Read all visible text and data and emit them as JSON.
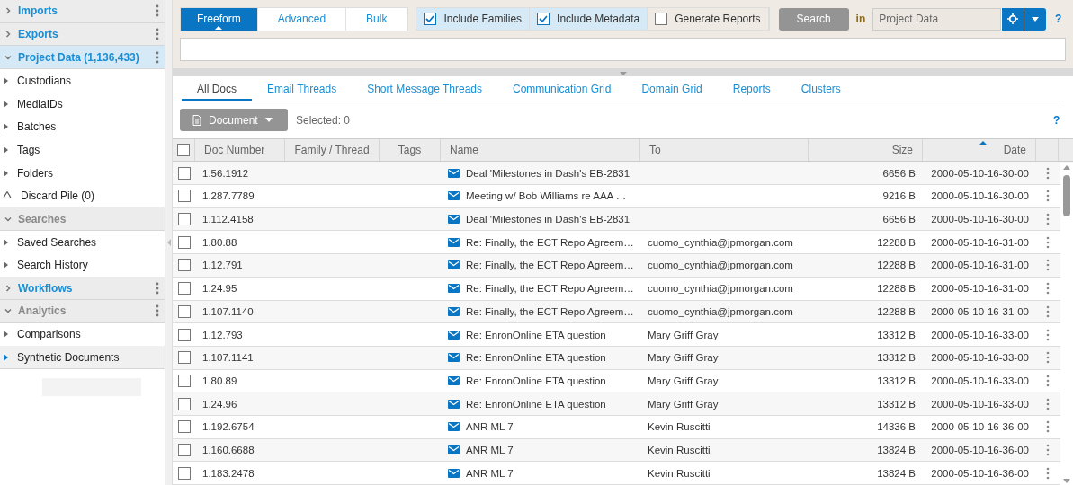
{
  "sidebar": {
    "sections": [
      {
        "label": "Imports",
        "expanded": false,
        "selected": false,
        "color": "#1a8ed4",
        "menu": true
      },
      {
        "label": "Exports",
        "expanded": false,
        "selected": false,
        "color": "#1a8ed4",
        "menu": true
      },
      {
        "label": "Project Data (1,136,433)",
        "expanded": true,
        "selected": true,
        "color": "#1a8ed4",
        "menu": true,
        "children": [
          {
            "label": "Custodians",
            "kind": "branch",
            "hovered": false
          },
          {
            "label": "MediaIDs",
            "kind": "branch",
            "hovered": false
          },
          {
            "label": "Batches",
            "kind": "branch",
            "hovered": false
          },
          {
            "label": "Tags",
            "kind": "branch",
            "hovered": false
          },
          {
            "label": "Folders",
            "kind": "branch",
            "hovered": false
          },
          {
            "label": "Discard Pile (0)",
            "kind": "discard",
            "hovered": false
          }
        ]
      },
      {
        "label": "Searches",
        "expanded": true,
        "selected": false,
        "color": "#8a8a8a",
        "menu": false,
        "children": [
          {
            "label": "Saved Searches",
            "kind": "branch",
            "hovered": false
          },
          {
            "label": "Search History",
            "kind": "branch",
            "hovered": false
          }
        ]
      },
      {
        "label": "Workflows",
        "expanded": false,
        "selected": false,
        "color": "#1a8ed4",
        "menu": true
      },
      {
        "label": "Analytics",
        "expanded": true,
        "selected": false,
        "color": "#8a8a8a",
        "menu": true,
        "children": [
          {
            "label": "Comparisons",
            "kind": "branch",
            "hovered": false
          },
          {
            "label": "Synthetic Documents",
            "kind": "branch",
            "hovered": true
          }
        ]
      }
    ]
  },
  "search": {
    "modes": [
      {
        "label": "Freeform",
        "selected": true
      },
      {
        "label": "Advanced",
        "selected": false
      },
      {
        "label": "Bulk",
        "selected": false
      }
    ],
    "options": [
      {
        "label": "Include Families",
        "checked": true
      },
      {
        "label": "Include Metadata",
        "checked": true
      },
      {
        "label": "Generate Reports",
        "checked": false
      }
    ],
    "search_button": {
      "label": "Search",
      "disabled": true
    },
    "in_label": "in",
    "scope": "Project Data",
    "help": "?"
  },
  "tabs": [
    {
      "label": "All Docs",
      "selected": true
    },
    {
      "label": "Email Threads",
      "selected": false
    },
    {
      "label": "Short Message Threads",
      "selected": false
    },
    {
      "label": "Communication Grid",
      "selected": false
    },
    {
      "label": "Domain Grid",
      "selected": false
    },
    {
      "label": "Reports",
      "selected": false
    },
    {
      "label": "Clusters",
      "selected": false
    }
  ],
  "toolbar": {
    "document_button": {
      "label": "Document",
      "disabled": true
    },
    "selected_count": "Selected: 0",
    "help": "?"
  },
  "table": {
    "all_checked": false,
    "columns": [
      {
        "label": "Doc Number",
        "sorted": false
      },
      {
        "label": "Family / Thread",
        "sorted": false
      },
      {
        "label": "Tags",
        "sorted": false
      },
      {
        "label": "Name",
        "sorted": false
      },
      {
        "label": "To",
        "sorted": false
      },
      {
        "label": "Size",
        "sorted": false
      },
      {
        "label": "Date",
        "sorted": true
      }
    ],
    "rows": [
      {
        "checked": false,
        "doc": "1.56.1912",
        "name": "Deal 'Milestones in Dash's EB-2831",
        "size": "6656 B",
        "date": "2000-05-10-16-30-00"
      },
      {
        "checked": false,
        "doc": "1.287.7789",
        "name": "Meeting w/ Bob Williams re AAA …",
        "size": "9216 B",
        "date": "2000-05-10-16-30-00"
      },
      {
        "checked": false,
        "doc": "1.112.4158",
        "name": "Deal 'Milestones in Dash's EB-2831",
        "size": "6656 B",
        "date": "2000-05-10-16-30-00"
      },
      {
        "checked": false,
        "doc": "1.80.88",
        "name": "Re: Finally, the ECT Repo Agreem…",
        "to": "cuomo_cynthia@jpmorgan.com",
        "size": "12288 B",
        "date": "2000-05-10-16-31-00"
      },
      {
        "checked": false,
        "doc": "1.12.791",
        "name": "Re: Finally, the ECT Repo Agreem…",
        "to": "cuomo_cynthia@jpmorgan.com",
        "size": "12288 B",
        "date": "2000-05-10-16-31-00"
      },
      {
        "checked": false,
        "doc": "1.24.95",
        "name": "Re: Finally, the ECT Repo Agreem…",
        "to": "cuomo_cynthia@jpmorgan.com",
        "size": "12288 B",
        "date": "2000-05-10-16-31-00"
      },
      {
        "checked": false,
        "doc": "1.107.1140",
        "name": "Re: Finally, the ECT Repo Agreem…",
        "to": "cuomo_cynthia@jpmorgan.com",
        "size": "12288 B",
        "date": "2000-05-10-16-31-00"
      },
      {
        "checked": false,
        "doc": "1.12.793",
        "name": "Re: EnronOnline ETA question",
        "to": "Mary Griff Gray",
        "size": "13312 B",
        "date": "2000-05-10-16-33-00"
      },
      {
        "checked": false,
        "doc": "1.107.1141",
        "name": "Re: EnronOnline ETA question",
        "to": "Mary Griff Gray",
        "size": "13312 B",
        "date": "2000-05-10-16-33-00"
      },
      {
        "checked": false,
        "doc": "1.80.89",
        "name": "Re: EnronOnline ETA question",
        "to": "Mary Griff Gray",
        "size": "13312 B",
        "date": "2000-05-10-16-33-00"
      },
      {
        "checked": false,
        "doc": "1.24.96",
        "name": "Re: EnronOnline ETA question",
        "to": "Mary Griff Gray",
        "size": "13312 B",
        "date": "2000-05-10-16-33-00"
      },
      {
        "checked": false,
        "doc": "1.192.6754",
        "name": "ANR ML 7",
        "to": "Kevin Ruscitti",
        "size": "14336 B",
        "date": "2000-05-10-16-36-00"
      },
      {
        "checked": false,
        "doc": "1.160.6688",
        "name": "ANR ML 7",
        "to": "Kevin Ruscitti",
        "size": "13824 B",
        "date": "2000-05-10-16-36-00"
      },
      {
        "checked": false,
        "doc": "1.183.2478",
        "name": "ANR ML 7",
        "to": "Kevin Ruscitti",
        "size": "13824 B",
        "date": "2000-05-10-16-36-00"
      }
    ]
  }
}
